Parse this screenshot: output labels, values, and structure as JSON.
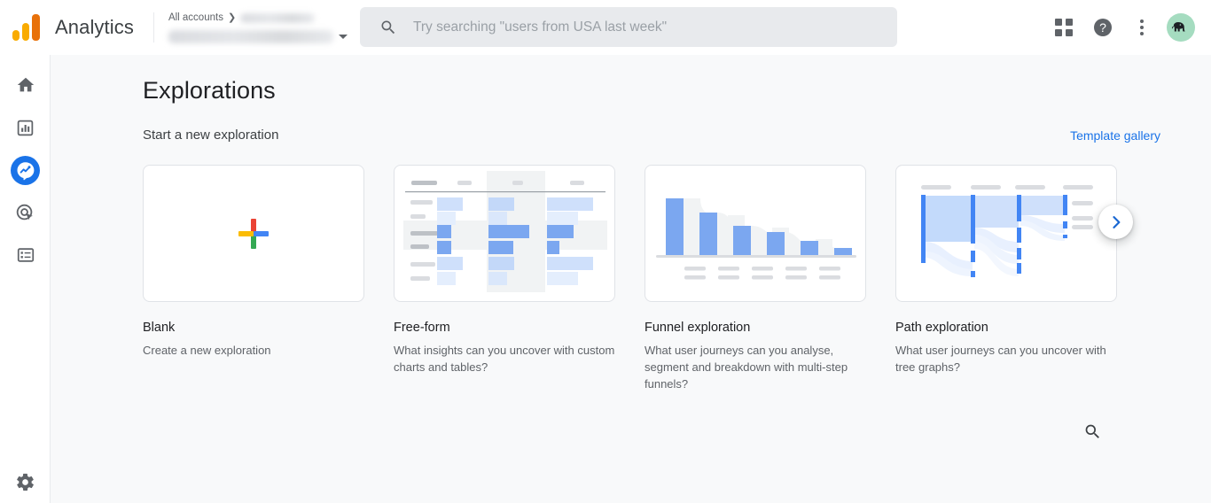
{
  "header": {
    "brand": "Analytics",
    "logo_icon": "analytics-logo-icon",
    "breadcrumb": {
      "all_accounts": "All accounts",
      "separator": "❯",
      "account_name_redacted": "",
      "property_name_redacted": ""
    },
    "search": {
      "placeholder": "Try searching \"users from USA last week\"",
      "value": "",
      "icon": "search-icon"
    },
    "actions": [
      {
        "name": "apps-grid-icon",
        "label": "Google apps"
      },
      {
        "name": "help-icon",
        "label": "?"
      },
      {
        "name": "more-options-icon",
        "label": "More options"
      },
      {
        "name": "avatar",
        "label": "Account"
      }
    ]
  },
  "sidebar": {
    "items": [
      {
        "id": "home",
        "icon": "home-icon",
        "label": "Home",
        "active": false
      },
      {
        "id": "reports",
        "icon": "reports-icon",
        "label": "Reports",
        "active": false
      },
      {
        "id": "explore",
        "icon": "explore-icon",
        "label": "Explore",
        "active": true
      },
      {
        "id": "advertising",
        "icon": "target-icon",
        "label": "Advertising",
        "active": false
      },
      {
        "id": "configure",
        "icon": "list-icon",
        "label": "Configure",
        "active": false
      }
    ],
    "footer": {
      "id": "admin",
      "icon": "gear-icon",
      "label": "Admin"
    }
  },
  "main": {
    "page_title": "Explorations",
    "section_label": "Start a new exploration",
    "template_gallery_link": "Template gallery",
    "next_arrow_icon": "chevron-right-icon",
    "search_icon": "search-icon",
    "cards": [
      {
        "id": "blank",
        "title": "Blank",
        "description": "Create a new exploration",
        "thumb": "plus-icon"
      },
      {
        "id": "free-form",
        "title": "Free-form",
        "description": "What insights can you uncover with custom charts and tables?",
        "thumb": "table-chart-thumbnail"
      },
      {
        "id": "funnel-exploration",
        "title": "Funnel exploration",
        "description": "What user journeys can you analyse, segment and breakdown with multi-step funnels?",
        "thumb": "funnel-chart-thumbnail"
      },
      {
        "id": "path-exploration",
        "title": "Path exploration",
        "description": "What user journeys can you uncover with tree graphs?",
        "thumb": "path-sankey-thumbnail"
      }
    ]
  },
  "colors": {
    "brand_blue": "#1a73e8",
    "google_red": "#ea4335",
    "google_yellow": "#fbbc04",
    "google_green": "#34a853",
    "logo_orange": "#e8710a",
    "logo_amber": "#f9ab00",
    "page_bg": "#f8f9fa",
    "text_primary": "#202124",
    "text_secondary": "#5f6368",
    "chart_blue": "#7ba7f0",
    "avatar_bg": "#a5dcc0"
  }
}
